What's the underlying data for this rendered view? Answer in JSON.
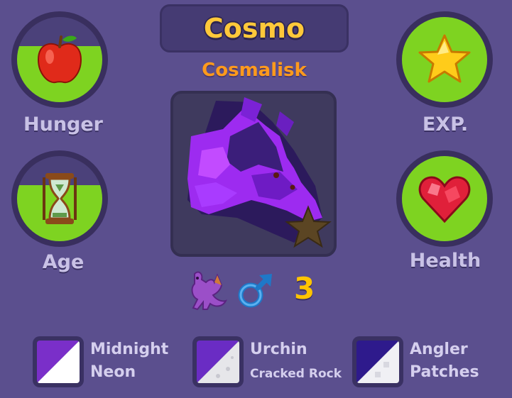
{
  "pet": {
    "name": "Cosmo",
    "species": "Cosmalisk",
    "age_number": "3",
    "gender_icon": "male-icon",
    "type_icon": "dragon-icon"
  },
  "stats": [
    {
      "id": "hunger",
      "label": "Hunger",
      "icon": "apple-icon",
      "fill": 0.66
    },
    {
      "id": "exp",
      "label": "EXP.",
      "icon": "star-icon",
      "fill": 1.0
    },
    {
      "id": "age",
      "label": "Age",
      "icon": "hourglass-icon",
      "fill": 0.66
    },
    {
      "id": "health",
      "label": "Health",
      "icon": "heart-icon",
      "fill": 1.0
    }
  ],
  "traits": [
    {
      "line1": "Midnight",
      "line2": "Neon",
      "color_a": "#7a2fc9",
      "color_b": "#ffffff"
    },
    {
      "line1": "Urchin",
      "line2": "Cracked Rock",
      "color_a": "#6a2cc4",
      "color_b": "#e6e6ea"
    },
    {
      "line1": "Angler",
      "line2": "Patches",
      "color_a": "#2e1a8c",
      "color_b": "#f0f0f4"
    }
  ],
  "colors": {
    "background": "#5b4f8e",
    "stat_fill": "#7ed321",
    "name_text": "#ffc83a",
    "species_text": "#ff9a1c"
  }
}
